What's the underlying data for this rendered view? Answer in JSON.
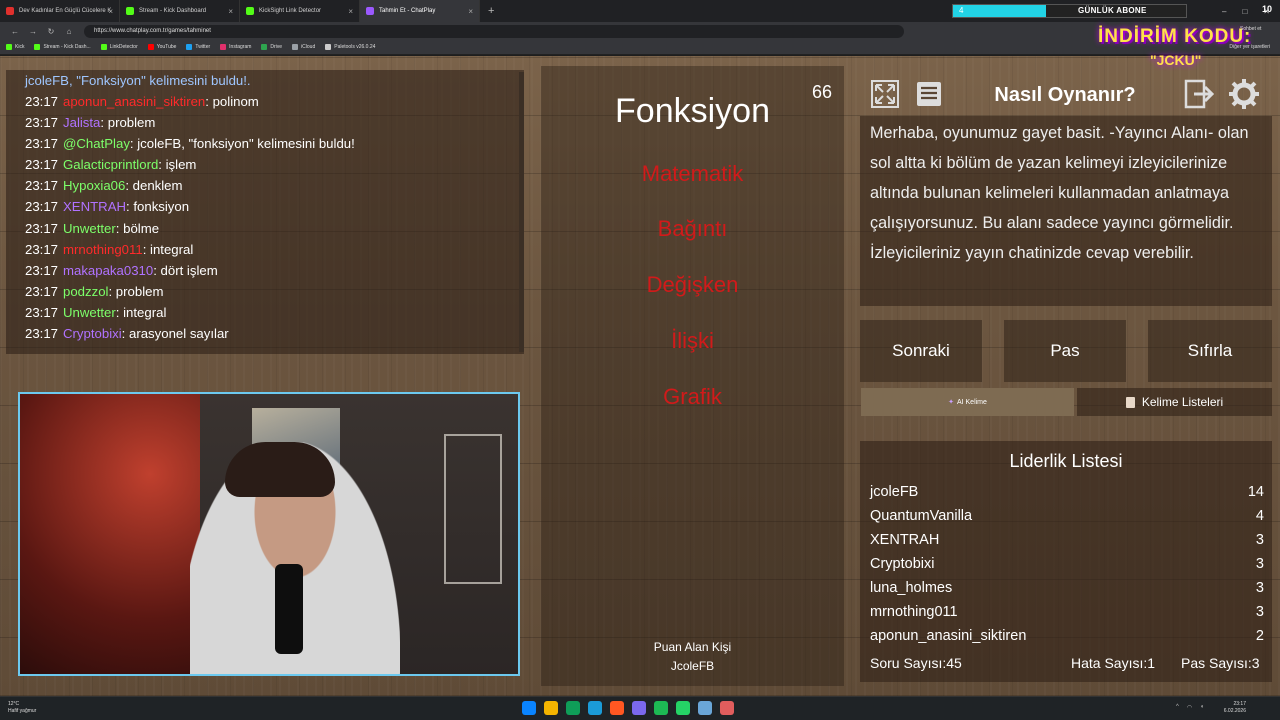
{
  "browser": {
    "tabs": [
      {
        "label": "Dev Kadınlar En Güçlü Cücelere K",
        "color": "#e0302d"
      },
      {
        "label": "Stream - Kick Dashboard",
        "color": "#53fc18"
      },
      {
        "label": "KickSight Link Detector",
        "color": "#53fc18"
      },
      {
        "label": "Tahmin Et - ChatPlay",
        "color": "#9b59ff"
      }
    ],
    "new_tab": "+",
    "url": "https://www.chatplay.com.tr/games/tahminet",
    "bookmarks": [
      {
        "label": "Kick",
        "color": "#53fc18"
      },
      {
        "label": "Stream - Kick Dash...",
        "color": "#53fc18"
      },
      {
        "label": "LinkDetector",
        "color": "#53fc18"
      },
      {
        "label": "YouTube",
        "color": "#ff0000"
      },
      {
        "label": "Twitter",
        "color": "#1da1f2"
      },
      {
        "label": "Instagram",
        "color": "#e1306c"
      },
      {
        "label": "Drive",
        "color": "#2ea44f"
      },
      {
        "label": "iCloud",
        "color": "#9aa0a6"
      },
      {
        "label": "Paletools v26.0.24",
        "color": "#cccccc"
      }
    ],
    "bookmarks_right": "Diğer yer işaretleri",
    "win_min": "–",
    "win_max": "□",
    "win_close": "✕"
  },
  "overlay": {
    "sub_goal_number": "4",
    "sub_goal_label": "GÜNLÜK ABONE",
    "sub_goal_count": "10",
    "sub_goal_fraction": 0.4,
    "promo_line1": "İNDİRİM KODU:",
    "promo_line2": "\"JCKU\"",
    "chat_btn": "Sohbet et"
  },
  "chat": {
    "first_line": "jcoleFB, \"Fonksiyon\" kelimesini buldu!.",
    "messages": [
      {
        "time": "23:17",
        "user": "aponun_anasini_siktiren",
        "color": "#ff2a2a",
        "text": ": polinom"
      },
      {
        "time": "23:17",
        "user": "Jalista",
        "color": "#b072ff",
        "text": ": problem"
      },
      {
        "time": "23:17",
        "user": "@ChatPlay",
        "color": "#7dff6a",
        "text": ": jcoleFB, \"fonksiyon\" kelimesini buldu!"
      },
      {
        "time": "23:17",
        "user": "Galacticprintlord",
        "color": "#7dff6a",
        "text": ": işlem"
      },
      {
        "time": "23:17",
        "user": "Hypoxia06",
        "color": "#7dff6a",
        "text": ": denklem"
      },
      {
        "time": "23:17",
        "user": "XENTRAH",
        "color": "#b072ff",
        "text": ": fonksiyon"
      },
      {
        "time": "23:17",
        "user": "Unwetter",
        "color": "#7dff6a",
        "text": ": bölme"
      },
      {
        "time": "23:17",
        "user": "mrnothing011",
        "color": "#ff2a2a",
        "text": ": integral"
      },
      {
        "time": "23:17",
        "user": "makapaka0310",
        "color": "#b072ff",
        "text": ": dört işlem"
      },
      {
        "time": "23:17",
        "user": "podzzol",
        "color": "#7dff6a",
        "text": ": problem"
      },
      {
        "time": "23:17",
        "user": "Unwetter",
        "color": "#7dff6a",
        "text": ": integral"
      },
      {
        "time": "23:17",
        "user": "Cryptobixi",
        "color": "#b072ff",
        "text": ": arasyonel sayılar"
      }
    ]
  },
  "game": {
    "word": "Fonksiyon",
    "timer": "66",
    "taboo_words": [
      "Matematik",
      "Bağıntı",
      "Değişken",
      "İlişki",
      "Grafik"
    ],
    "scorer_label": "Puan Alan Kişi",
    "scorer_name": "JcoleFB"
  },
  "howto": {
    "title": "Nasıl Oynanır?",
    "text": "Merhaba, oyunumuz gayet basit. -Yayıncı Alanı- olan sol altta ki bölüm de yazan kelimeyi izleyicilerinize altında bulunan kelimeleri kullanmadan anlatmaya çalışıyorsunuz. Bu alanı sadece yayıncı görmelidir. İzleyicileriniz yayın chatinizde cevap verebilir."
  },
  "controls": {
    "next": "Sonraki",
    "pass": "Pas",
    "reset": "Sıfırla",
    "ai_word": "AI Kelime",
    "word_lists": "Kelime Listeleri"
  },
  "leaderboard": {
    "title": "Liderlik Listesi",
    "rows": [
      {
        "name": "jcoleFB",
        "score": "14"
      },
      {
        "name": "QuantumVanilla",
        "score": "4"
      },
      {
        "name": "XENTRAH",
        "score": "3"
      },
      {
        "name": "Cryptobixi",
        "score": "3"
      },
      {
        "name": "luna_holmes",
        "score": "3"
      },
      {
        "name": "mrnothing011",
        "score": "3"
      },
      {
        "name": "aponun_anasini_siktiren",
        "score": "2"
      }
    ],
    "questions": "Soru Sayısı:45",
    "errors": "Hata Sayısı:1",
    "passes": "Pas Sayısı:3"
  },
  "taskbar": {
    "temp": "12°C",
    "weather": "Hafif yağmur",
    "time": "23:17",
    "date": "6.02.2026",
    "icon_colors": [
      "#0a84ff",
      "#f4b400",
      "#0f9d58",
      "#1b9bd8",
      "#ff5722",
      "#7b68ee",
      "#1db954",
      "#25d366",
      "#6aa6d8",
      "#e05d5d"
    ]
  }
}
